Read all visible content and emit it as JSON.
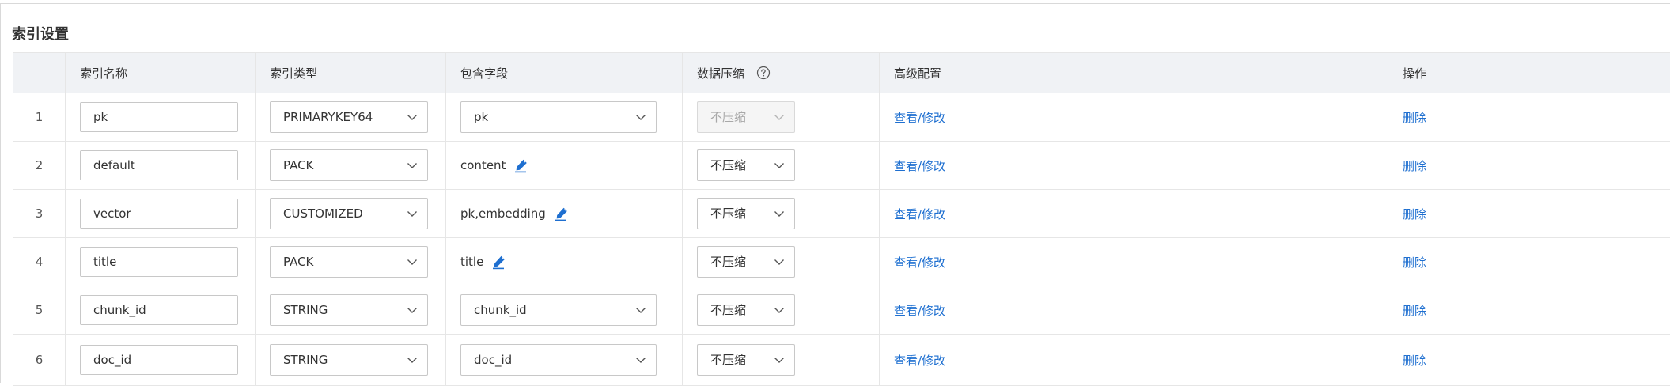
{
  "section": {
    "title": "索引设置"
  },
  "table": {
    "headers": {
      "index_name": "索引名称",
      "index_type": "索引类型",
      "fields": "包含字段",
      "compression": "数据压缩",
      "advanced": "高级配置",
      "actions": "操作"
    },
    "rows": [
      {
        "num": "1",
        "name": "pk",
        "type": "PRIMARYKEY64",
        "fields": "pk",
        "fields_mode": "select",
        "compression": "不压缩",
        "compression_disabled": true,
        "advanced_link": "查看/修改",
        "delete_link": "删除"
      },
      {
        "num": "2",
        "name": "default",
        "type": "PACK",
        "fields": "content",
        "fields_mode": "text",
        "compression": "不压缩",
        "compression_disabled": false,
        "advanced_link": "查看/修改",
        "delete_link": "删除"
      },
      {
        "num": "3",
        "name": "vector",
        "type": "CUSTOMIZED",
        "fields": "pk,embedding",
        "fields_mode": "text",
        "compression": "不压缩",
        "compression_disabled": false,
        "advanced_link": "查看/修改",
        "delete_link": "删除"
      },
      {
        "num": "4",
        "name": "title",
        "type": "PACK",
        "fields": "title",
        "fields_mode": "text",
        "compression": "不压缩",
        "compression_disabled": false,
        "advanced_link": "查看/修改",
        "delete_link": "删除"
      },
      {
        "num": "5",
        "name": "chunk_id",
        "type": "STRING",
        "fields": "chunk_id",
        "fields_mode": "select",
        "compression": "不压缩",
        "compression_disabled": false,
        "advanced_link": "查看/修改",
        "delete_link": "删除"
      },
      {
        "num": "6",
        "name": "doc_id",
        "type": "STRING",
        "fields": "doc_id",
        "fields_mode": "select",
        "compression": "不压缩",
        "compression_disabled": false,
        "advanced_link": "查看/修改",
        "delete_link": "删除"
      }
    ]
  },
  "icons": {
    "chevron": "chevron-down-icon",
    "edit": "pencil-edit-icon",
    "help": "question-circle-icon"
  },
  "colors": {
    "link": "#1e6fd0",
    "header_bg": "#f0f2f5",
    "border": "#e6e6e6",
    "edit_icon": "#1e6fd0"
  }
}
